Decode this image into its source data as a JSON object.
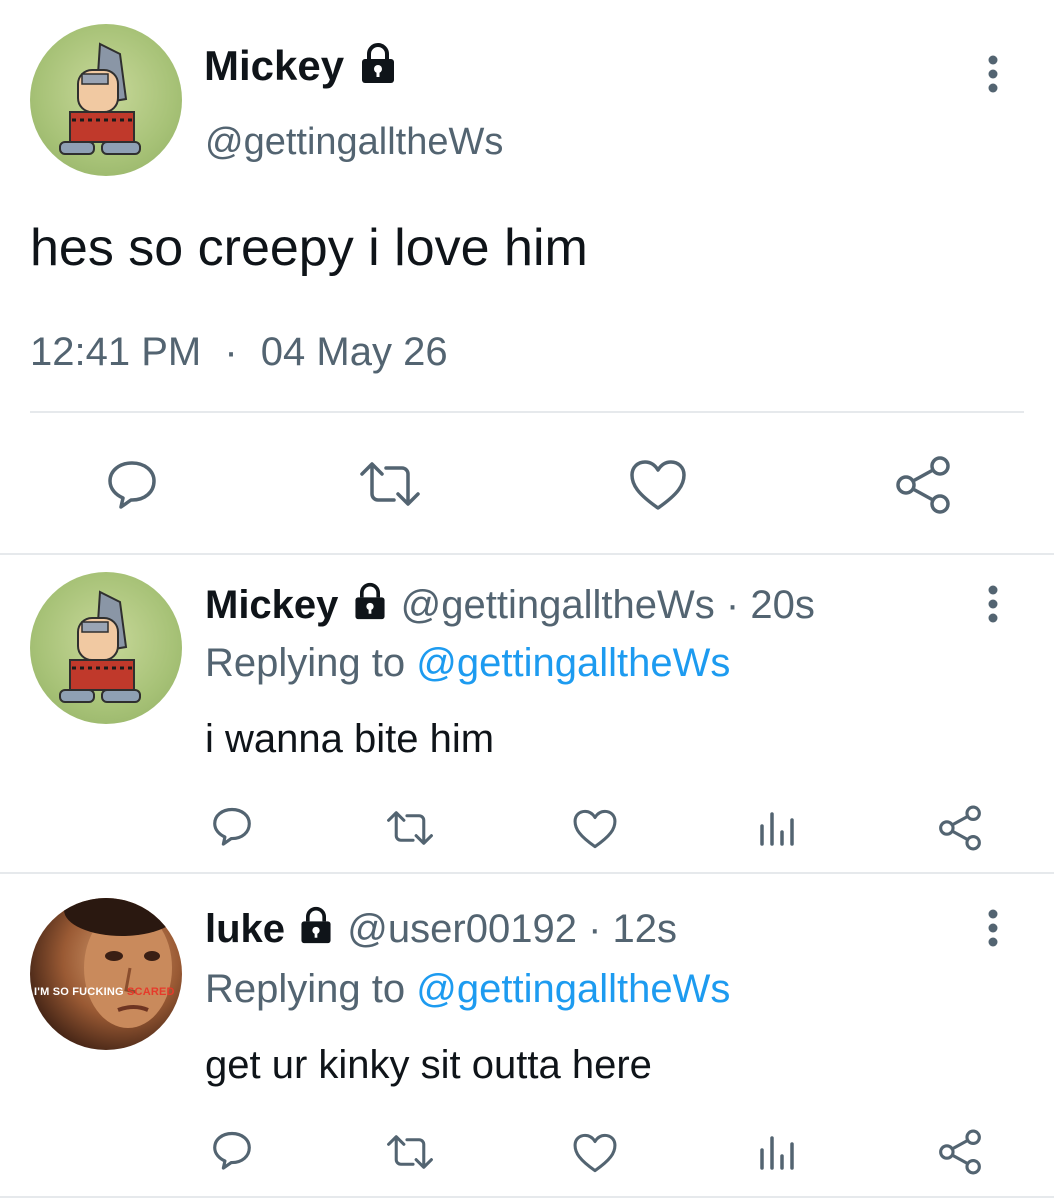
{
  "main_tweet": {
    "display_name": "Mickey",
    "handle": "@gettingalltheWs",
    "text": "hes so creepy i love him",
    "time": "12:41 PM",
    "separator": "·",
    "date": "04 May 26"
  },
  "replies": [
    {
      "display_name": "Mickey",
      "handle": "@gettingalltheWs",
      "age": "· 20s",
      "replying_prefix": "Replying to",
      "replying_to": "@gettingalltheWs",
      "text": "i wanna bite him"
    },
    {
      "display_name": "luke",
      "handle": "@user00192",
      "age": "· 12s",
      "replying_prefix": "Replying to",
      "replying_to": "@gettingalltheWs",
      "text": "get ur kinky sit outta here",
      "avatar_caption_white": "I'M SO FUCKING",
      "avatar_caption_red": "SCARED"
    }
  ],
  "icons": {
    "reply": "reply-bubble-icon",
    "retweet": "retweet-icon",
    "like": "heart-icon",
    "analytics": "analytics-icon",
    "share": "share-icon",
    "more": "more-vertical-icon",
    "lock": "lock-icon"
  },
  "colors": {
    "text": "#0f1419",
    "secondary": "#536471",
    "link": "#1d9bf0",
    "divider": "#e6e9ec"
  }
}
